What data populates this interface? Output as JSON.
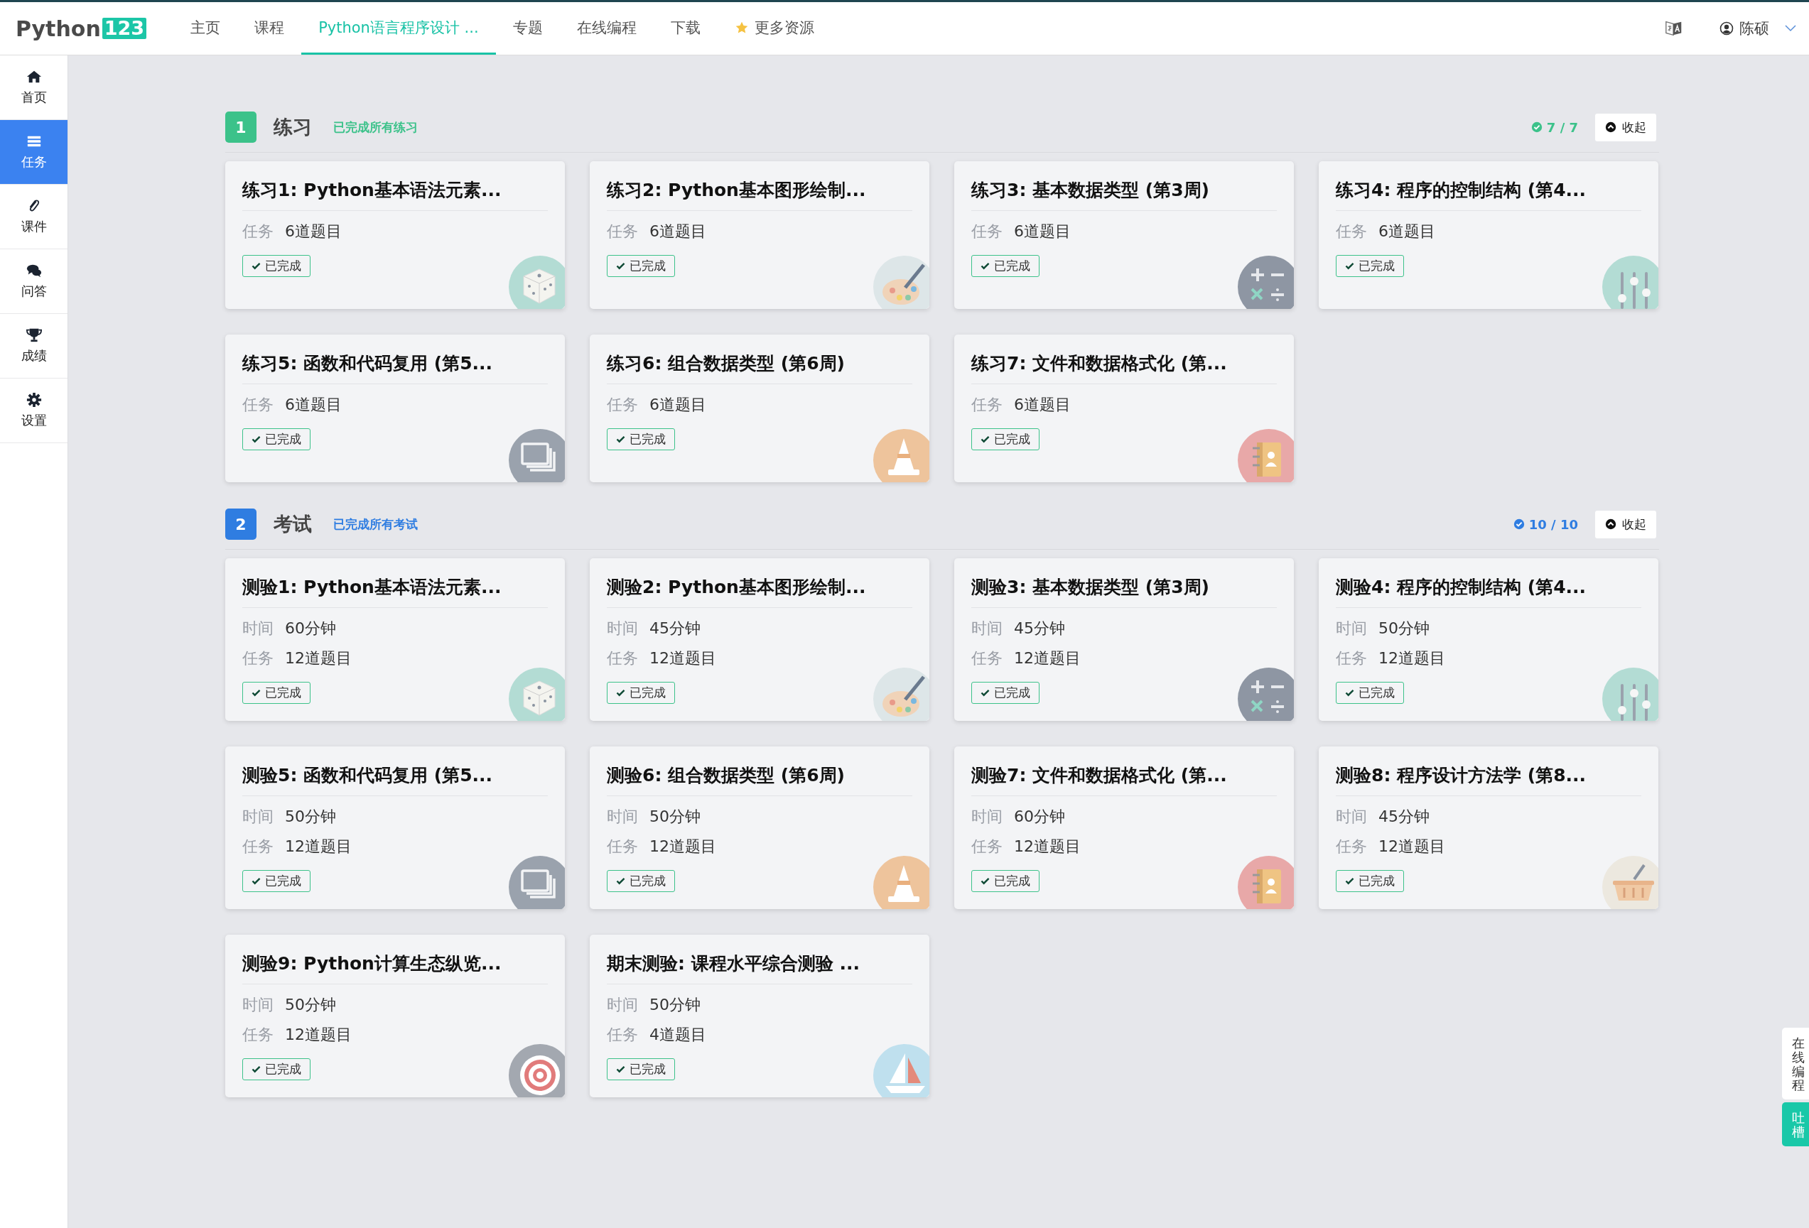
{
  "nav": {
    "logo": {
      "text": "Python",
      "badge": "123"
    },
    "items": [
      {
        "label": "主页",
        "selected": false,
        "kind": "link"
      },
      {
        "label": "课程",
        "selected": false,
        "kind": "link"
      },
      {
        "label": "Python语言程序设计 ...",
        "selected": true,
        "kind": "link"
      },
      {
        "label": "专题",
        "selected": false,
        "kind": "link"
      },
      {
        "label": "在线编程",
        "selected": false,
        "kind": "link"
      },
      {
        "label": "下载",
        "selected": false,
        "kind": "link"
      },
      {
        "label": "更多资源",
        "selected": false,
        "kind": "starred"
      }
    ],
    "user": {
      "name": "陈硕"
    }
  },
  "sidebar": {
    "items": [
      {
        "label": "首页",
        "selected": false
      },
      {
        "label": "任务",
        "selected": true
      },
      {
        "label": "课件",
        "selected": false
      },
      {
        "label": "问答",
        "selected": false
      },
      {
        "label": "成绩",
        "selected": false
      },
      {
        "label": "设置",
        "selected": false
      }
    ]
  },
  "sections": [
    {
      "number": "1",
      "title": "练习",
      "summary": "已完成所有练习",
      "color": "#3cc28a",
      "progress": "7 / 7",
      "collapse": "收起",
      "cards": [
        {
          "title": "练习1: Python基本语法元素...",
          "meta": [
            {
              "label": "任务",
              "value": "6道题目"
            }
          ],
          "status": "已完成"
        },
        {
          "title": "练习2: Python基本图形绘制...",
          "meta": [
            {
              "label": "任务",
              "value": "6道题目"
            }
          ],
          "status": "已完成"
        },
        {
          "title": "练习3: 基本数据类型 (第3周)",
          "meta": [
            {
              "label": "任务",
              "value": "6道题目"
            }
          ],
          "status": "已完成"
        },
        {
          "title": "练习4: 程序的控制结构 (第4...",
          "meta": [
            {
              "label": "任务",
              "value": "6道题目"
            }
          ],
          "status": "已完成"
        },
        {
          "title": "练习5: 函数和代码复用 (第5...",
          "meta": [
            {
              "label": "任务",
              "value": "6道题目"
            }
          ],
          "status": "已完成"
        },
        {
          "title": "练习6: 组合数据类型 (第6周)",
          "meta": [
            {
              "label": "任务",
              "value": "6道题目"
            }
          ],
          "status": "已完成"
        },
        {
          "title": "练习7: 文件和数据格式化 (第...",
          "meta": [
            {
              "label": "任务",
              "value": "6道题目"
            }
          ],
          "status": "已完成"
        }
      ]
    },
    {
      "number": "2",
      "title": "考试",
      "summary": "已完成所有考试",
      "color": "#2f7de1",
      "progress": "10 / 10",
      "collapse": "收起",
      "cards": [
        {
          "title": "测验1: Python基本语法元素...",
          "meta": [
            {
              "label": "时间",
              "value": "60分钟"
            },
            {
              "label": "任务",
              "value": "12道题目"
            }
          ],
          "status": "已完成"
        },
        {
          "title": "测验2: Python基本图形绘制...",
          "meta": [
            {
              "label": "时间",
              "value": "45分钟"
            },
            {
              "label": "任务",
              "value": "12道题目"
            }
          ],
          "status": "已完成"
        },
        {
          "title": "测验3: 基本数据类型 (第3周)",
          "meta": [
            {
              "label": "时间",
              "value": "45分钟"
            },
            {
              "label": "任务",
              "value": "12道题目"
            }
          ],
          "status": "已完成"
        },
        {
          "title": "测验4: 程序的控制结构 (第4...",
          "meta": [
            {
              "label": "时间",
              "value": "50分钟"
            },
            {
              "label": "任务",
              "value": "12道题目"
            }
          ],
          "status": "已完成"
        },
        {
          "title": "测验5: 函数和代码复用 (第5...",
          "meta": [
            {
              "label": "时间",
              "value": "50分钟"
            },
            {
              "label": "任务",
              "value": "12道题目"
            }
          ],
          "status": "已完成"
        },
        {
          "title": "测验6: 组合数据类型 (第6周)",
          "meta": [
            {
              "label": "时间",
              "value": "50分钟"
            },
            {
              "label": "任务",
              "value": "12道题目"
            }
          ],
          "status": "已完成"
        },
        {
          "title": "测验7: 文件和数据格式化 (第...",
          "meta": [
            {
              "label": "时间",
              "value": "60分钟"
            },
            {
              "label": "任务",
              "value": "12道题目"
            }
          ],
          "status": "已完成"
        },
        {
          "title": "测验8: 程序设计方法学 (第8...",
          "meta": [
            {
              "label": "时间",
              "value": "45分钟"
            },
            {
              "label": "任务",
              "value": "12道题目"
            }
          ],
          "status": "已完成"
        },
        {
          "title": "测验9: Python计算生态纵览...",
          "meta": [
            {
              "label": "时间",
              "value": "50分钟"
            },
            {
              "label": "任务",
              "value": "12道题目"
            }
          ],
          "status": "已完成"
        },
        {
          "title": "期末测验: 课程水平综合测验 ...",
          "meta": [
            {
              "label": "时间",
              "value": "50分钟"
            },
            {
              "label": "任务",
              "value": "4道题目"
            }
          ],
          "status": "已完成"
        }
      ]
    }
  ],
  "side_tabs": [
    {
      "label": "在线编程",
      "kind": "plain"
    },
    {
      "label": "吐槽",
      "kind": "accent"
    }
  ]
}
